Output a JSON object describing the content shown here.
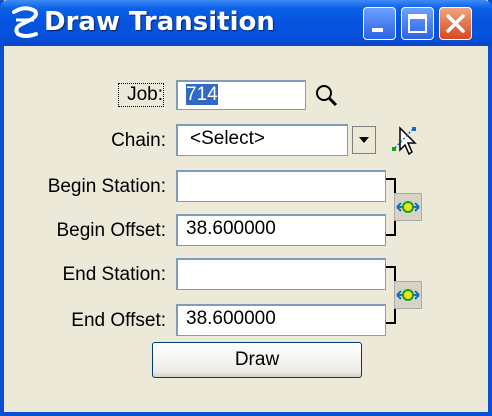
{
  "window": {
    "title": "Draw Transition",
    "accent": "#0553de",
    "close_color": "#d8481c"
  },
  "form": {
    "job": {
      "label": "Job:",
      "value": "714",
      "icons": [
        "search-icon"
      ]
    },
    "chain": {
      "label": "Chain:",
      "value": "<Select>",
      "icons": [
        "chevron-down-icon",
        "pick-cursor-icon"
      ]
    },
    "begin_station": {
      "label": "Begin Station:",
      "value": ""
    },
    "begin_offset": {
      "label": "Begin Offset:",
      "value": "38.600000"
    },
    "end_station": {
      "label": "End Station:",
      "value": ""
    },
    "end_offset": {
      "label": "End Offset:",
      "value": "38.600000"
    },
    "lock_icon": "target-lock-icon"
  },
  "actions": {
    "draw_label": "Draw"
  }
}
